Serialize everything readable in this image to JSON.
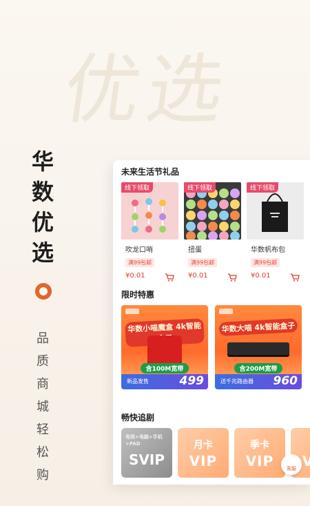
{
  "watermark": "优选",
  "brand": {
    "chars": [
      "华",
      "数",
      "优",
      "选"
    ]
  },
  "slogan": {
    "chars": [
      "品",
      "质",
      "商",
      "城",
      "轻",
      "松",
      "购"
    ]
  },
  "sections": {
    "gifts_title": "未来生活节礼品",
    "deals_title": "限时特惠",
    "drama_title": "畅快追剧"
  },
  "gifts": [
    {
      "tag": "线下领取",
      "name": "吹龙口哨",
      "pill": "满99包邮",
      "price": "¥0.01"
    },
    {
      "tag": "线下领取",
      "name": "扭蛋",
      "pill": "满99包邮",
      "price": "¥0.01"
    },
    {
      "tag": "线下领取",
      "name": "华数帆布包",
      "pill": "满99包邮",
      "price": "¥0.01"
    }
  ],
  "deals": [
    {
      "title": "华数小喵魔盒 4k智能盒子",
      "speed": "含100M宽带",
      "sub": "新品发售",
      "price": "499"
    },
    {
      "title": "华数大喵 4k智能盒子",
      "speed": "含200M宽带",
      "sub": "送千兆路由器",
      "price": "960"
    }
  ],
  "vips": [
    {
      "small": "电视+电脑+手机+PAD",
      "big": "SVIP"
    },
    {
      "small": "月卡",
      "big": "VIP"
    },
    {
      "small": "季卡",
      "big": "VIP"
    },
    {
      "small": "年",
      "big": "VIP"
    }
  ],
  "float_button": {
    "label": "客服"
  },
  "colors": {
    "accent": "#e2652b",
    "price": "#e33b2b",
    "tag": "#e84a6a"
  }
}
